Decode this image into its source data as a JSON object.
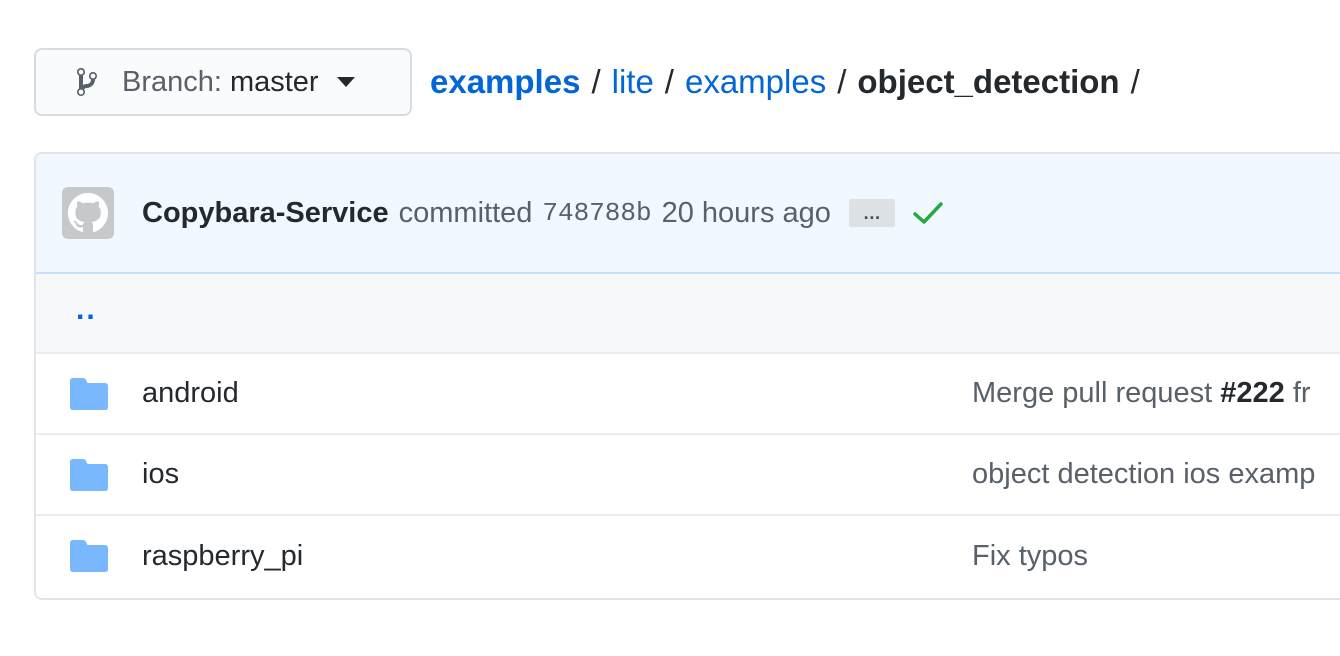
{
  "branch": {
    "prefix": "Branch:",
    "name": "master"
  },
  "breadcrumb": {
    "items": [
      "examples",
      "lite",
      "examples"
    ],
    "current": "object_detection",
    "separator": "/"
  },
  "commit": {
    "author": "Copybara-Service",
    "action": "committed",
    "sha": "748788b",
    "age": "20 hours ago",
    "ellipsis": "…",
    "status": "success"
  },
  "parent_link": "..",
  "files": [
    {
      "name": "android",
      "type": "folder",
      "message_prefix": "Merge pull request ",
      "message_pr": "#222",
      "message_suffix": " fr"
    },
    {
      "name": "ios",
      "type": "folder",
      "message_prefix": "object detection ios examp",
      "message_pr": "",
      "message_suffix": ""
    },
    {
      "name": "raspberry_pi",
      "type": "folder",
      "message_prefix": "Fix typos",
      "message_pr": "",
      "message_suffix": ""
    }
  ],
  "colors": {
    "link": "#0366d6",
    "folder": "#79b8ff",
    "success": "#28a745",
    "commit_bar_bg": "#f1f8ff"
  }
}
